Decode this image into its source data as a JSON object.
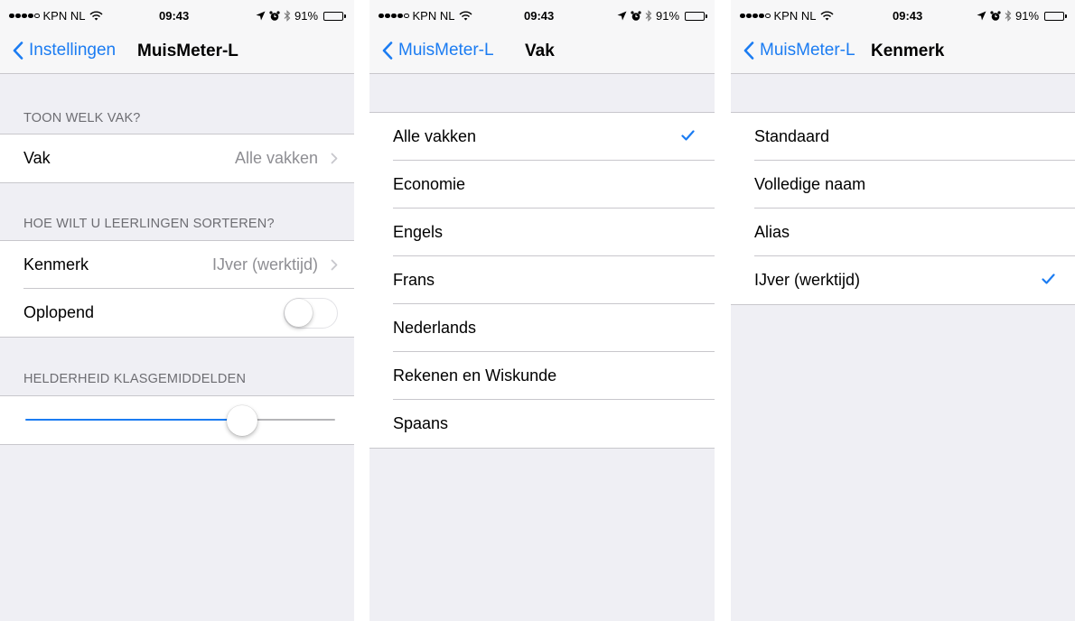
{
  "status_bar": {
    "carrier": "KPN NL",
    "time": "09:43",
    "battery": "91%",
    "battery_level": 0.91
  },
  "colors": {
    "accent": "#1b7cf2",
    "background": "#efeff4",
    "separator": "#c8c7cc",
    "detail_text": "#8e8e93"
  },
  "screen1": {
    "back_label": "Instellingen",
    "title": "MuisMeter-L",
    "section_vak_header": "TOON WELK VAK?",
    "vak_label": "Vak",
    "vak_value": "Alle vakken",
    "section_sort_header": "HOE WILT U LEERLINGEN SORTEREN?",
    "kenmerk_label": "Kenmerk",
    "kenmerk_value": "IJver (werktijd)",
    "oplopend_label": "Oplopend",
    "oplopend_on": false,
    "section_brightness_header": "HELDERHEID KLASGEMIDDELDEN",
    "brightness_value": 0.7
  },
  "screen2": {
    "back_label": "MuisMeter-L",
    "title": "Vak",
    "options": [
      "Alle vakken",
      "Economie",
      "Engels",
      "Frans",
      "Nederlands",
      "Rekenen en Wiskunde",
      "Spaans"
    ],
    "selected_index": 0
  },
  "screen3": {
    "back_label": "MuisMeter-L",
    "title": "Kenmerk",
    "options": [
      "Standaard",
      "Volledige naam",
      "Alias",
      "IJver (werktijd)"
    ],
    "selected_index": 3
  },
  "icons": {
    "back": "chevron-left-icon",
    "disclosure": "chevron-right-icon",
    "selected": "checkmark-icon",
    "wifi": "wifi-icon",
    "location": "location-arrow-icon",
    "alarm": "alarm-icon",
    "bluetooth": "bluetooth-icon",
    "battery": "battery-icon"
  }
}
